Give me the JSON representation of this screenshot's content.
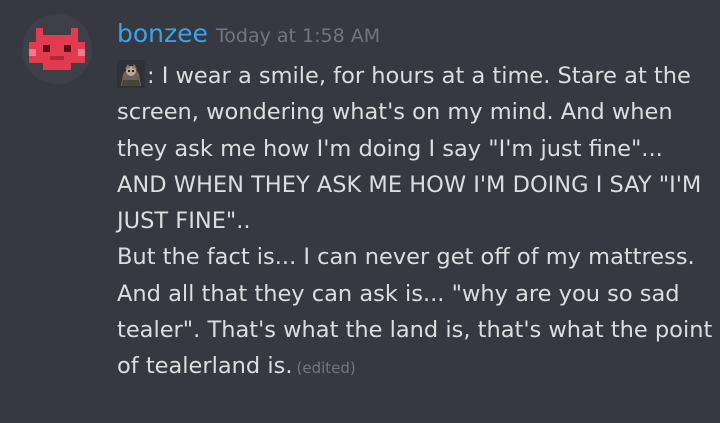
{
  "message": {
    "author": {
      "username": "bonzee",
      "avatar_icon": "pixel-creature-avatar",
      "username_color": "#3aa3e9"
    },
    "timestamp": "Today at 1:58 AM",
    "emoji_icon": "custom-emoji-character",
    "text_first": ": I wear a smile, for hours at a time. Stare at the screen, wondering what's on my mind. And when they ask me how I'm doing I say \"I'm just fine\"... AND WHEN THEY ASK ME HOW I'M DOING I SAY \"I'M JUST FINE\"..",
    "text_second": "But the fact is... I can never get off of my mattress. And all that they can ask is... \"why are you so sad tealer\". That's what the land is, that's what the point of tealerland is.",
    "edited_label": "(edited)"
  },
  "colors": {
    "background": "#36393f",
    "text": "#dcddde",
    "muted": "#72767d",
    "avatar_red": "#e23b4f"
  }
}
